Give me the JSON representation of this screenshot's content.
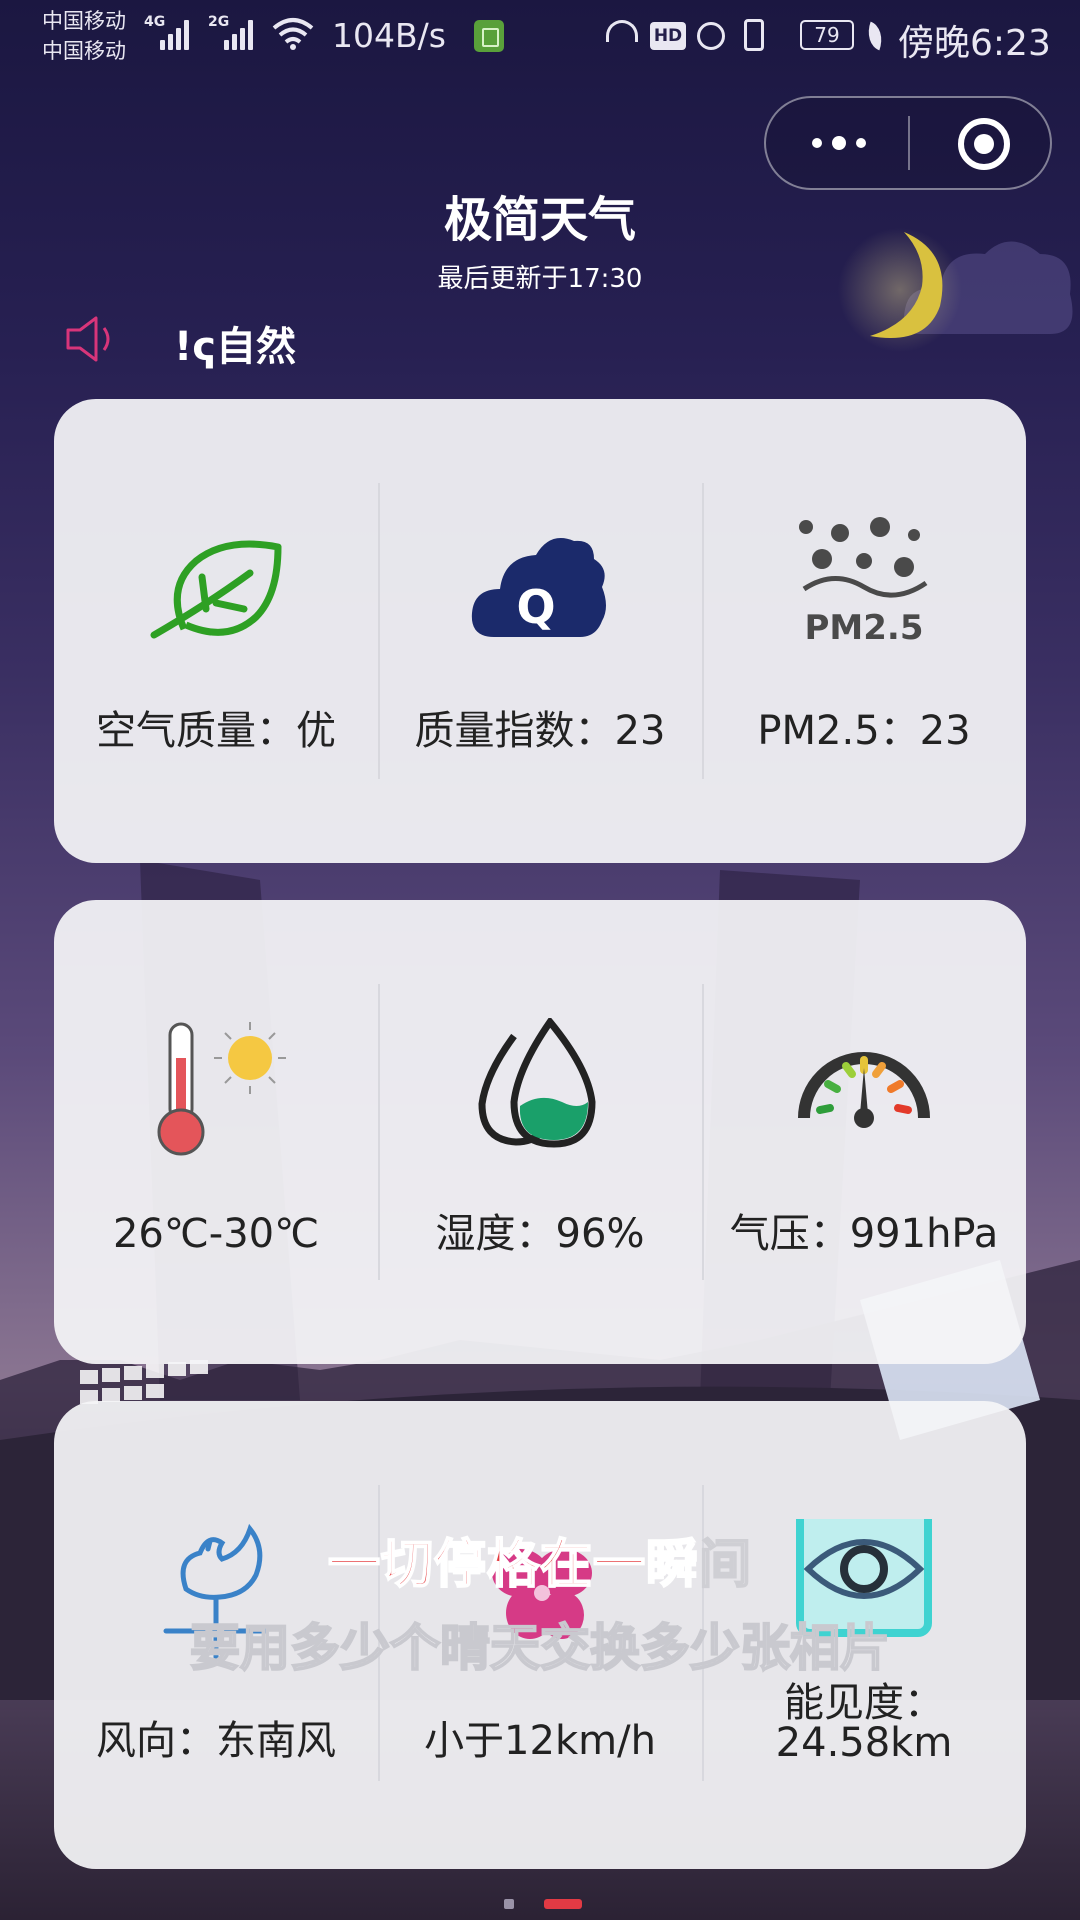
{
  "status_bar": {
    "carrier1": "中国移动",
    "carrier2": "中国移动",
    "net1": "4G",
    "net2": "2G",
    "speed": "104B/s",
    "hd": "HD",
    "battery": "79",
    "time": "傍晚6:23"
  },
  "capsule": {
    "more_icon": "more-dots-icon",
    "close_icon": "target-close-icon"
  },
  "header": {
    "title": "极简天气",
    "updated": "最后更新于17:30"
  },
  "notice": {
    "text": "ҁ自然!",
    "icon": "speaker-icon"
  },
  "cards": [
    {
      "items": [
        {
          "icon": "leaf-icon",
          "label": "空气质量：优"
        },
        {
          "icon": "cloud-q-icon",
          "label": "质量指数：23"
        },
        {
          "icon": "pm25-icon",
          "label": "PM2.5：23"
        }
      ]
    },
    {
      "items": [
        {
          "icon": "thermometer-sun-icon",
          "label": "26℃-30℃"
        },
        {
          "icon": "humidity-drops-icon",
          "label": "湿度：96%"
        },
        {
          "icon": "pressure-gauge-icon",
          "label": "气压：991hPa"
        }
      ]
    },
    {
      "items": [
        {
          "icon": "weathervane-icon",
          "label": "风向：东南风"
        },
        {
          "icon": "fan-icon",
          "label": "小于12km/h"
        },
        {
          "icon": "eye-icon",
          "label_line1": "能见度：",
          "label_line2": "24.58km"
        }
      ]
    }
  ],
  "lyrics": {
    "line1_highlight": "一切停格在一瞬",
    "line1_rest": "间",
    "line2": "要用多少个晴天交换多少张相片"
  },
  "pager": {
    "count": 2,
    "active_index": 1
  },
  "colors": {
    "accent_red": "#e23a44",
    "lyric_red": "#e43b3f",
    "leaf_green": "#2ea024",
    "cloud_navy": "#1b2a6b",
    "eye_teal": "#3fd3d1"
  }
}
